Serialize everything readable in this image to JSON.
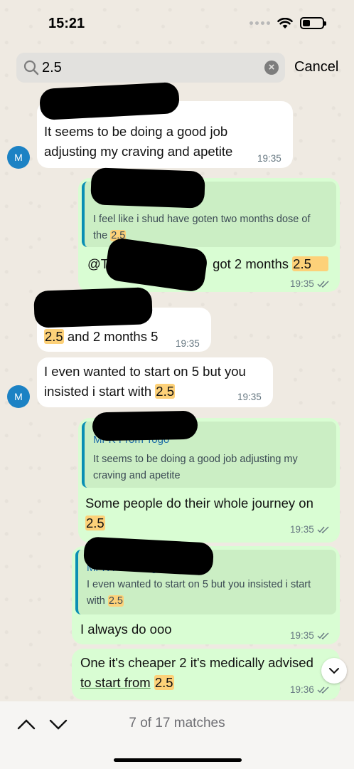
{
  "status_bar": {
    "time": "15:21"
  },
  "search": {
    "query": "2.5",
    "cancel_label": "Cancel"
  },
  "messages": [
    {
      "avatar": "M",
      "text_a": "It seems to be doing a good job",
      "text_b": "adjusting my craving and apetite",
      "time": "19:35"
    },
    {
      "quote_text_a": "I feel like i shud have goten two months dose of",
      "quote_text_b": "the",
      "quote_hl": "2.5",
      "text_pre": "@Tari E",
      "text_post": "got 2 months",
      "text_hl": "2.5",
      "time": "19:35"
    },
    {
      "text_hl": "2.5",
      "text_post": "and 2 months 5",
      "time": "19:35"
    },
    {
      "avatar": "M",
      "text_a": "I even wanted to start on 5 but you",
      "text_b": "insisted i start with",
      "text_hl": "2.5",
      "time": "19:35"
    },
    {
      "quote_name": "Mr K From Togo",
      "quote_text_a": "It seems to be doing a good job adjusting my",
      "quote_text_b": "craving and apetite",
      "text_a": "Some people do their whole journey on",
      "text_hl": "2.5",
      "time": "19:35"
    },
    {
      "quote_name": "Mr K From Togo",
      "quote_text_a": "I even wanted to start on 5 but you insisted i start",
      "quote_text_b": "with",
      "quote_hl": "2.5",
      "text_a": "I always do ooo",
      "time": "19:35"
    },
    {
      "text_a": "One it's cheaper 2 it's medically advised",
      "text_b_pre": "to start from",
      "text_hl": "2.5",
      "time": "19:36"
    }
  ],
  "bottom_bar": {
    "match_count": "7 of 17 matches"
  }
}
